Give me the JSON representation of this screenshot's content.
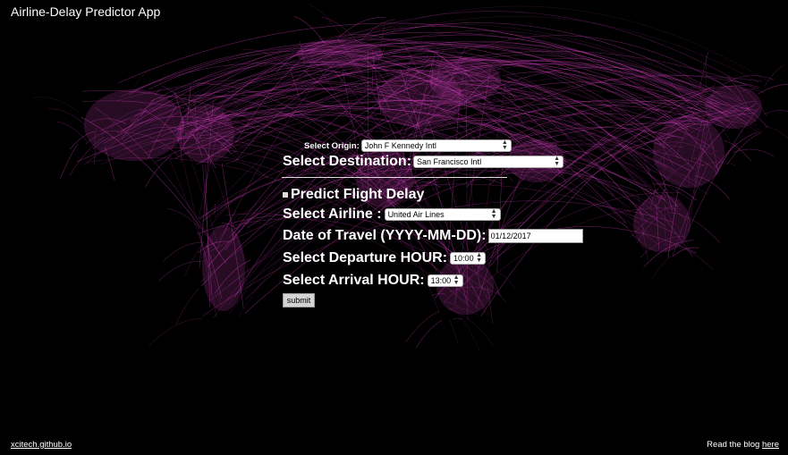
{
  "app": {
    "title": "Airline-Delay Predictor App"
  },
  "form": {
    "origin_label": "Select Origin:",
    "origin_value": "John F Kennedy Intl",
    "destination_label": "Select Destination:",
    "destination_value": "San Francisco Intl",
    "section_title": "Predict Flight Delay",
    "airline_label": "Select Airline :",
    "airline_value": "United Air Lines",
    "date_label": "Date of Travel (YYYY-MM-DD):",
    "date_value": "01/12/2017",
    "departure_label": "Select Departure HOUR:",
    "departure_value": "10:00",
    "arrival_label": "Select Arrival HOUR:",
    "arrival_value": "13:00",
    "submit_label": "submit"
  },
  "footer": {
    "site_link": "xcitech.github.io",
    "blog_text": "Read the blog",
    "blog_link": "here"
  },
  "colors": {
    "background": "#000000",
    "routes": "#e040c8"
  }
}
